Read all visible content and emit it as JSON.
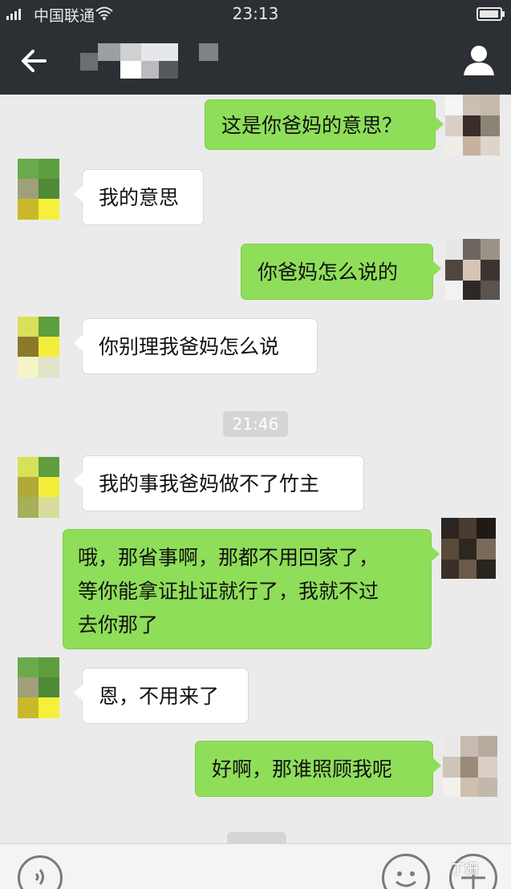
{
  "status_bar": {
    "carrier": "中国联通",
    "time": "23:13"
  },
  "nav": {
    "back_icon": "arrow-left-icon",
    "profile_icon": "person-icon"
  },
  "messages": [
    {
      "side": "out",
      "text": "这是你爸妈的意思？"
    },
    {
      "side": "in",
      "text": "我的意思"
    },
    {
      "side": "out",
      "text": "你爸妈怎么说的"
    },
    {
      "side": "in",
      "text": "你别理我爸妈怎么说"
    },
    {
      "side": "in",
      "text": "我的事我爸妈做不了竹主"
    },
    {
      "side": "out",
      "lines": [
        "哦，那省事啊，那都不用回家了，",
        "等你能拿证扯证就行了，我就不过",
        "去你那了"
      ]
    },
    {
      "side": "in",
      "text": "恩，不用来了"
    },
    {
      "side": "out",
      "text": "好啊，那谁照顾我呢"
    }
  ],
  "timestamp": "21:46",
  "input_bar": {
    "voice_icon": "voice-icon",
    "emoji_icon": "emoji-icon",
    "more_icon": "plus-icon"
  },
  "watermark": "丁姗",
  "colors": {
    "header": "#2c2f33",
    "background": "#ebebeb",
    "outgoing_bubble": "#8fde5a",
    "incoming_bubble": "#ffffff"
  }
}
